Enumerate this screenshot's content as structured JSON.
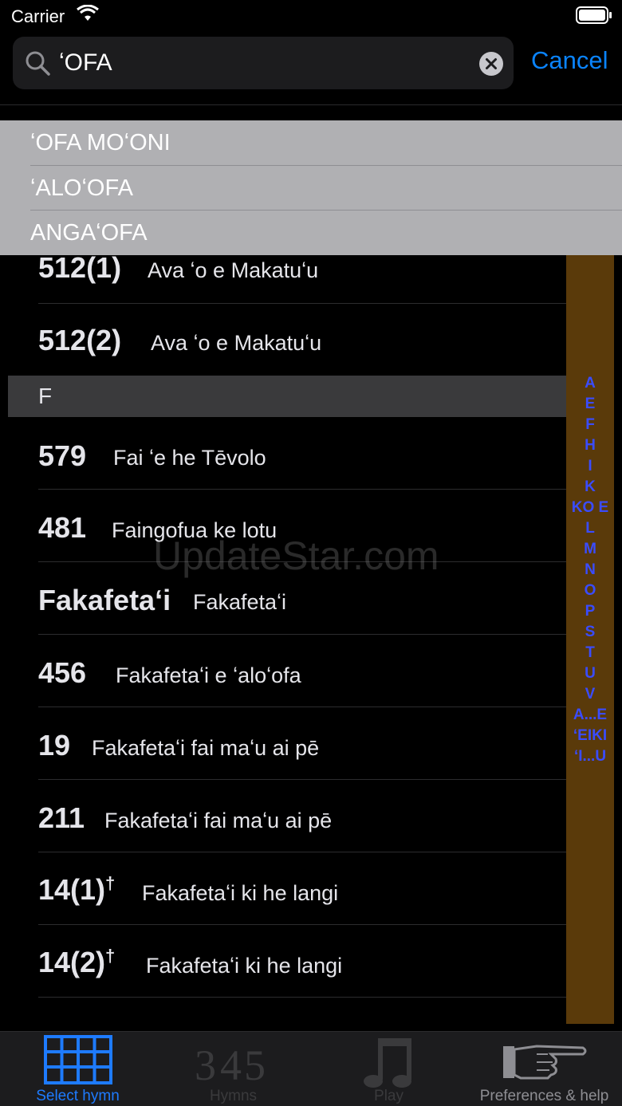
{
  "status": {
    "carrier": "Carrier"
  },
  "search": {
    "value": "ʻOFA",
    "cancel_label": "Cancel"
  },
  "suggestions": [
    "ʻOFA MOʻONI",
    "ʻALOʻOFA",
    "ANGAʻOFA"
  ],
  "hymns_before_f": [
    {
      "number": "512(1)",
      "title": "Ava ʻo e Makatuʻu"
    },
    {
      "number": "512(2)",
      "title": "Ava ʻo e Makatuʻu"
    }
  ],
  "section_f": "F",
  "hymns_f": [
    {
      "number": "579",
      "title": "Fai ʻe he Tēvolo"
    },
    {
      "number": "481",
      "title": "Faingofua ke lotu"
    },
    {
      "number": "Fakafetaʻi",
      "title": "Fakafetaʻi"
    },
    {
      "number": "456",
      "title": "Fakafetaʻi e ʻaloʻofa"
    },
    {
      "number": "19",
      "title": "Fakafetaʻi fai maʻu ai pē"
    },
    {
      "number": "211",
      "title": "Fakafetaʻi fai maʻu ai pē"
    },
    {
      "number": "14(1)",
      "dagger": "†",
      "title": "Fakafetaʻi ki he langi"
    },
    {
      "number": "14(2)",
      "dagger": "†",
      "title": "Fakafetaʻi ki he langi"
    }
  ],
  "index": [
    "A",
    "E",
    "F",
    "H",
    "I",
    "K",
    "KO E",
    "L",
    "M",
    "N",
    "O",
    "P",
    "S",
    "T",
    "U",
    "V",
    "A...E",
    "ʻEIKI",
    "ʻI...U"
  ],
  "watermark": "UpdateStar.com",
  "tabs": [
    {
      "label": "Select hymn",
      "icon": "grid-icon",
      "active": true
    },
    {
      "label": "Hymns",
      "icon": "hymn-numbers-icon",
      "active": false
    },
    {
      "label": "Play",
      "icon": "music-note-icon",
      "active": false
    },
    {
      "label": "Preferences & help",
      "icon": "pointing-hand-icon",
      "active": false
    }
  ],
  "colors": {
    "accent": "#0a84ff",
    "index_bg": "#5a3a0a",
    "index_text": "#3a4cff",
    "tab_active": "#1e7bff"
  }
}
